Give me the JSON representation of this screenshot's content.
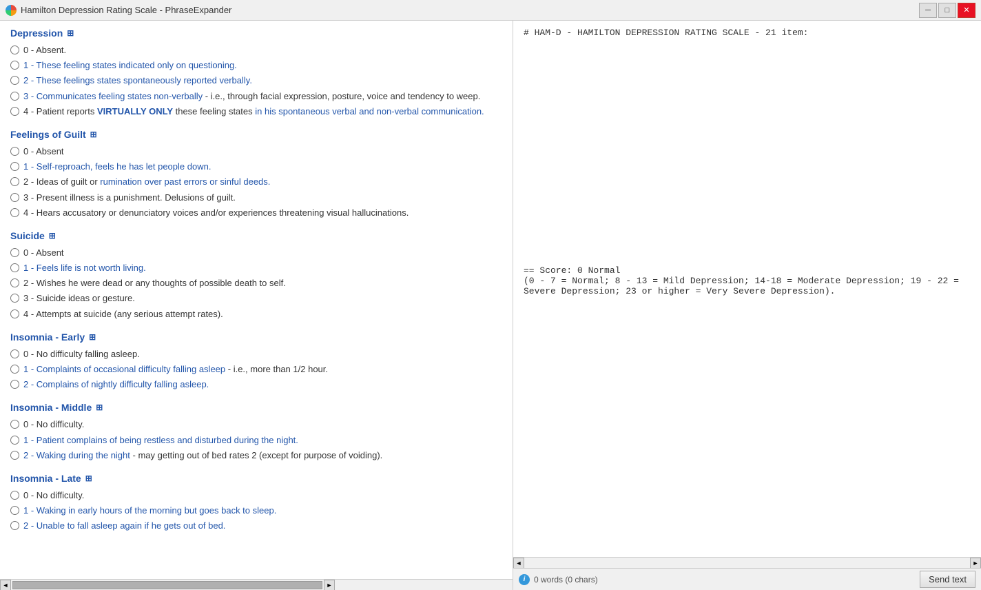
{
  "titleBar": {
    "title": "Hamilton Depression Rating Scale - PhraseExpander",
    "minimizeLabel": "─",
    "maximizeLabel": "□",
    "closeLabel": "✕"
  },
  "sections": [
    {
      "id": "depression",
      "title": "Depression",
      "options": [
        {
          "value": "0",
          "label": "0 - Absent."
        },
        {
          "value": "1",
          "label": "1 - These feeling states indicated only on questioning.",
          "highlight": true
        },
        {
          "value": "2",
          "label": "2 - These feelings states spontaneously reported verbally.",
          "highlight": true
        },
        {
          "value": "3",
          "label": "3 - Communicates feeling states non-verbally - i.e., through facial expression, posture, voice and tendency to weep.",
          "highlight": true
        },
        {
          "value": "4",
          "label": "4 - Patient reports VIRTUALLY ONLY these feeling states in his spontaneous verbal and non-verbal communication.",
          "highlight": true
        }
      ]
    },
    {
      "id": "feelings-of-guilt",
      "title": "Feelings of Guilt",
      "options": [
        {
          "value": "0",
          "label": "0 - Absent"
        },
        {
          "value": "1",
          "label": "1 - Self-reproach, feels he has let people down.",
          "highlight": true
        },
        {
          "value": "2",
          "label": "2 - Ideas of guilt or rumination over past errors or sinful deeds.",
          "highlight": true
        },
        {
          "value": "3",
          "label": "3 - Present illness is a punishment. Delusions of guilt."
        },
        {
          "value": "4",
          "label": "4 - Hears accusatory or denunciatory voices and/or experiences threatening visual hallucinations."
        }
      ]
    },
    {
      "id": "suicide",
      "title": "Suicide",
      "options": [
        {
          "value": "0",
          "label": "0 - Absent"
        },
        {
          "value": "1",
          "label": "1 - Feels life is not worth living.",
          "highlight": true
        },
        {
          "value": "2",
          "label": "2 - Wishes he were dead or any thoughts of possible death to self."
        },
        {
          "value": "3",
          "label": "3 - Suicide ideas or gesture."
        },
        {
          "value": "4",
          "label": "4 - Attempts at suicide (any serious attempt rates)."
        }
      ]
    },
    {
      "id": "insomnia-early",
      "title": "Insomnia - Early",
      "options": [
        {
          "value": "0",
          "label": "0 - No difficulty falling asleep."
        },
        {
          "value": "1",
          "label": "1 - Complaints of occasional difficulty falling asleep - i.e., more than 1/2 hour.",
          "highlight": true
        },
        {
          "value": "2",
          "label": "2 - Complains of nightly difficulty falling asleep.",
          "highlight": true
        }
      ]
    },
    {
      "id": "insomnia-middle",
      "title": "Insomnia - Middle",
      "options": [
        {
          "value": "0",
          "label": "0 - No difficulty."
        },
        {
          "value": "1",
          "label": "1 - Patient complains of being restless and disturbed during the night.",
          "highlight": true
        },
        {
          "value": "2",
          "label": "2 - Waking during the night - may getting out of bed rates 2 (except for purpose of voiding).",
          "highlight": true
        }
      ]
    },
    {
      "id": "insomnia-late",
      "title": "Insomnia - Late",
      "options": [
        {
          "value": "0",
          "label": "0 - No difficulty."
        },
        {
          "value": "1",
          "label": "1 - Waking in early hours of the morning but goes back to sleep.",
          "highlight": true
        },
        {
          "value": "2",
          "label": "2 - Unable to fall asleep again if he gets out of bed.",
          "highlight": true
        }
      ]
    }
  ],
  "rightPanel": {
    "content": "# HAM-D - HAMILTON DEPRESSION RATING SCALE - 21 item:\n\n\n\n\n\n\n\n\n\n\n\n\n\n\n\n\n\n\n\n\n\n\n== Score: 0 Normal\n(0 - 7 = Normal; 8 - 13 = Mild Depression; 14-18 = Moderate Depression; 19 - 22 = Severe Depression; 23 or higher = Very Severe Depression)."
  },
  "statusBar": {
    "infoText": "0 words (0 chars)",
    "sendTextLabel": "Send text"
  }
}
